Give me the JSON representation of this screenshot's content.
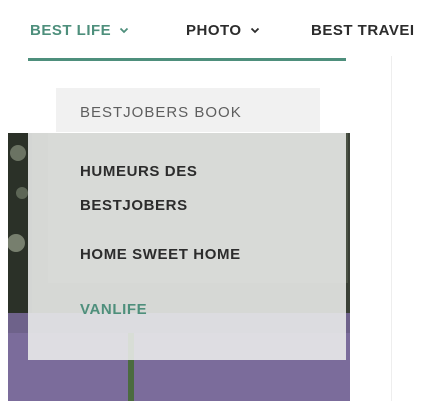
{
  "nav": {
    "items": [
      {
        "label": "BEST LIFE",
        "active": true,
        "has_dropdown": true
      },
      {
        "label": "PHOTO",
        "active": false,
        "has_dropdown": true
      },
      {
        "label": "BEST TRAVEI",
        "active": false,
        "has_dropdown": false
      }
    ]
  },
  "dropdown": {
    "items": [
      {
        "label": "BESTJOBERS BOOK"
      },
      {
        "label": "HUMEURS DES BESTJOBERS"
      },
      {
        "label": "HOME SWEET HOME"
      },
      {
        "label": "VANLIFE",
        "active": true
      }
    ]
  },
  "colors": {
    "accent": "#4e8f7c",
    "text": "#2c2c2c",
    "dropdown_bg": "#ecedec"
  },
  "icons": {
    "chevron": "chevron-down-icon"
  }
}
